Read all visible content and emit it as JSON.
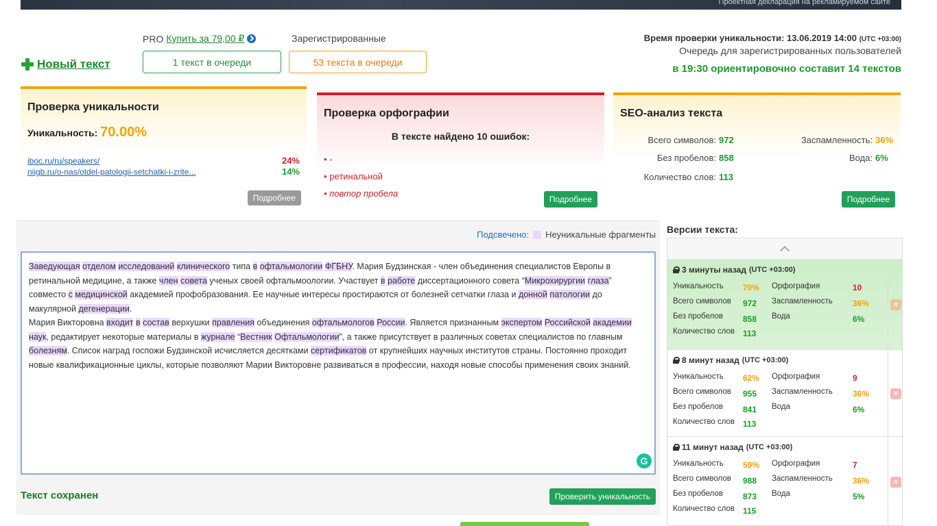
{
  "banner": {
    "text": "Проектная декларация на рекламируемом сайте"
  },
  "header": {
    "new_text": "Новый текст",
    "pro_label": "PRO",
    "pro_buy": "Купить за 79,00 ₽",
    "registered_label": "Зарегистрированные",
    "queue_pro": "1 текст в очереди",
    "queue_registered": "53 текста в очереди",
    "check_time_label": "Время проверки уникальности: 13.06.2019 14:00",
    "check_time_tz": "(UTC +03:00)",
    "queue_info": "Очередь для зарегистрированных пользователей",
    "queue_estimate": "в 19:30 ориентировочно составит 14 текстов"
  },
  "uniqueness_card": {
    "title": "Проверка уникальности",
    "label": "Уникальность:",
    "value": "70.00%",
    "sources": [
      {
        "url": "iboc.ru/ru/speakers/",
        "percent": "24%"
      },
      {
        "url": "niigb.ru/o-nas/otdel-patologii-setchatki-i-zrite...",
        "percent": "14%"
      }
    ],
    "more_label": "Подробнее"
  },
  "spelling_card": {
    "title": "Проверка орфографии",
    "found": "В тексте найдено 10 ошибок:",
    "errors": [
      "• -",
      "• ретинальной",
      "• повтор пробела"
    ],
    "more_label": "Подробнее"
  },
  "seo_card": {
    "title": "SEO-анализ текста",
    "total_chars_label": "Всего символов:",
    "total_chars": "972",
    "no_spaces_label": "Без пробелов:",
    "no_spaces": "858",
    "words_label": "Количество слов:",
    "words": "113",
    "spam_label": "Заспамленность:",
    "spam": "36%",
    "water_label": "Вода:",
    "water": "6%",
    "more_label": "Подробнее"
  },
  "editor": {
    "legend_label": "Подсвечено:",
    "legend_text": "Неуникальные фрагменты",
    "saved": "Текст сохранен",
    "check_button": "Проверить уникальность"
  },
  "versions": {
    "title": "Версии текста:",
    "labels": {
      "uniq": "Уникальность",
      "spell": "Орфография",
      "total": "Всего символов",
      "spam": "Заспамленность",
      "nospace": "Без пробелов",
      "water": "Вода",
      "words": "Количество слов"
    },
    "items": [
      {
        "time": "3 минуты назад",
        "tz": "(UTC +03:00)",
        "uniq": "70%",
        "spell": "10",
        "total": "972",
        "spam": "36%",
        "nospace": "858",
        "water": "6%",
        "words": "113"
      },
      {
        "time": "8 минут назад",
        "tz": "(UTC +03:00)",
        "uniq": "62%",
        "spell": "9",
        "total": "955",
        "spam": "36%",
        "nospace": "841",
        "water": "6%",
        "words": "113"
      },
      {
        "time": "11 минут назад",
        "tz": "(UTC +03:00)",
        "uniq": "59%",
        "spell": "7",
        "total": "988",
        "spam": "36%",
        "nospace": "873",
        "water": "5%",
        "words": "115"
      }
    ]
  },
  "colors": {
    "accent_green": "#22a05a",
    "accent_orange": "#f3a20c",
    "error_red": "#d01f2a",
    "highlight": "#ead7ff"
  },
  "editor_text": [
    [
      "Заведующая",
      true
    ],
    [
      " ",
      false
    ],
    [
      "отделом",
      true
    ],
    [
      " ",
      false
    ],
    [
      "исследований",
      true
    ],
    [
      " ",
      false
    ],
    [
      "клинического",
      true
    ],
    [
      " типа ",
      false
    ],
    [
      "в",
      true
    ],
    [
      " ",
      false
    ],
    [
      "офтальмологии",
      true
    ],
    [
      " ",
      false
    ],
    [
      "ФГБНУ",
      true
    ],
    [
      ". Мария Будзинская - член объединения специалистов Европы в ретинальной медицине, а также ",
      false
    ],
    [
      "член",
      true
    ],
    [
      "  ",
      false
    ],
    [
      "совета",
      true
    ],
    [
      " ученых своей офтальмоологии. Участвует ",
      false
    ],
    [
      "в",
      true
    ],
    [
      " ",
      false
    ],
    [
      "работе",
      true
    ],
    [
      " диссертационного совета “",
      false
    ],
    [
      "Микрохирургии",
      true
    ],
    [
      " ",
      false
    ],
    [
      "глаза",
      true
    ],
    [
      "” совместо ",
      false
    ],
    [
      "с",
      true
    ],
    [
      " ",
      false
    ],
    [
      "медицинской",
      true
    ],
    [
      " академией профобразования. Ее научные интересы простираются от болезней сетчатки глаза и ",
      false
    ],
    [
      "донной",
      true
    ],
    [
      " ",
      false
    ],
    [
      "патологии",
      true
    ],
    [
      " до макулярной ",
      false
    ],
    [
      "дегенерации",
      true
    ],
    [
      ".\nМария Викторовна ",
      false
    ],
    [
      "входит",
      true
    ],
    [
      " ",
      false
    ],
    [
      "в",
      true
    ],
    [
      " ",
      false
    ],
    [
      "состав",
      true
    ],
    [
      " верхушки ",
      false
    ],
    [
      "правления",
      true
    ],
    [
      " объединения ",
      false
    ],
    [
      "офтальмологов",
      true
    ],
    [
      " ",
      false
    ],
    [
      "России",
      true
    ],
    [
      ". Является признанным ",
      false
    ],
    [
      "экспертом",
      true
    ],
    [
      " ",
      false
    ],
    [
      "Российской",
      true
    ],
    [
      " ",
      false
    ],
    [
      "академии",
      true
    ],
    [
      " ",
      false
    ],
    [
      "наук",
      true
    ],
    [
      ", редактирует некоторые материалы в ",
      false
    ],
    [
      "журнале",
      true
    ],
    [
      " “",
      false
    ],
    [
      "Вестник",
      true
    ],
    [
      " ",
      false
    ],
    [
      "Офтальмологии",
      true
    ],
    [
      "”, а также присутствует в различных советах специалистов по главным ",
      false
    ],
    [
      "болезням",
      true
    ],
    [
      ". Список наград госпожи Будзинской исчисляется десятками ",
      false
    ],
    [
      "сертификатов",
      true
    ],
    [
      " от крупнейших научных институтов страны. Постоянно проходит новые квалификационные циклы, которые позволяют Марии Викторовне развиваться в профессии, находя новые способы применения своих знаний.",
      false
    ]
  ]
}
